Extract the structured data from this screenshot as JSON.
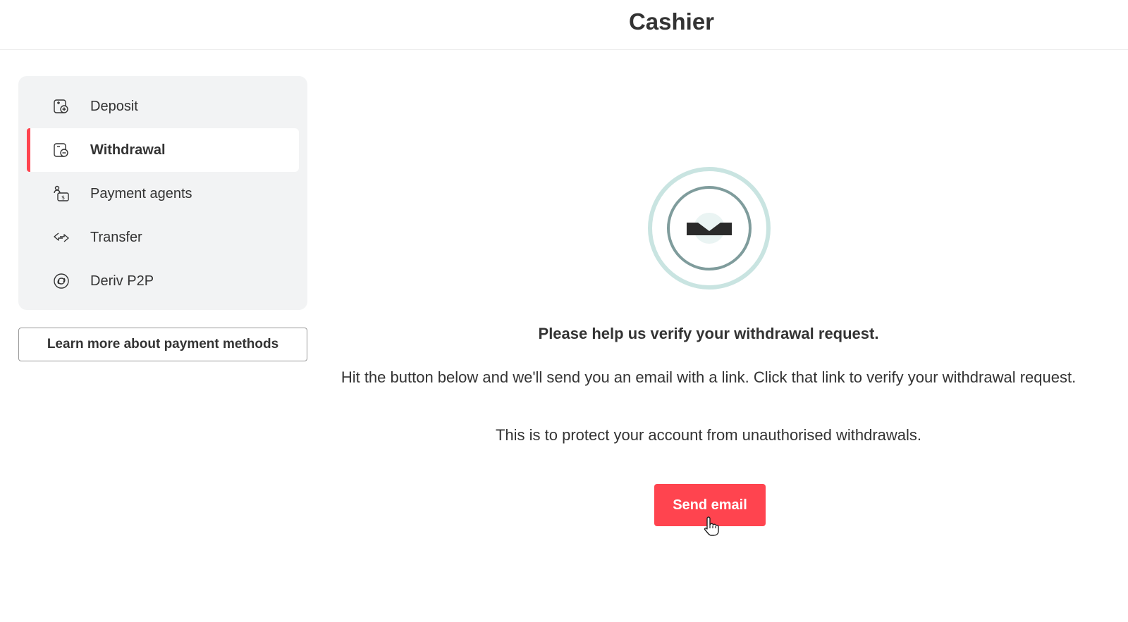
{
  "header": {
    "title": "Cashier"
  },
  "sidebar": {
    "items": [
      {
        "label": "Deposit",
        "icon": "deposit-icon",
        "active": false
      },
      {
        "label": "Withdrawal",
        "icon": "withdrawal-icon",
        "active": true
      },
      {
        "label": "Payment agents",
        "icon": "payment-agents-icon",
        "active": false
      },
      {
        "label": "Transfer",
        "icon": "transfer-icon",
        "active": false
      },
      {
        "label": "Deriv P2P",
        "icon": "deriv-p2p-icon",
        "active": false
      }
    ],
    "learn_more_label": "Learn more about payment methods"
  },
  "main": {
    "illustration_icon": "email-verification-icon",
    "heading": "Please help us verify your withdrawal request.",
    "description": "Hit the button below and we'll send you an email with a link. Click that link to verify your withdrawal request.",
    "note": "This is to protect your account from unauthorised withdrawals.",
    "send_email_label": "Send email"
  },
  "colors": {
    "accent": "#ff444f",
    "sidebar_bg": "#f2f3f4",
    "illustration_ring": "#c9e4e1",
    "illustration_inner_ring": "#7f9c9c"
  }
}
